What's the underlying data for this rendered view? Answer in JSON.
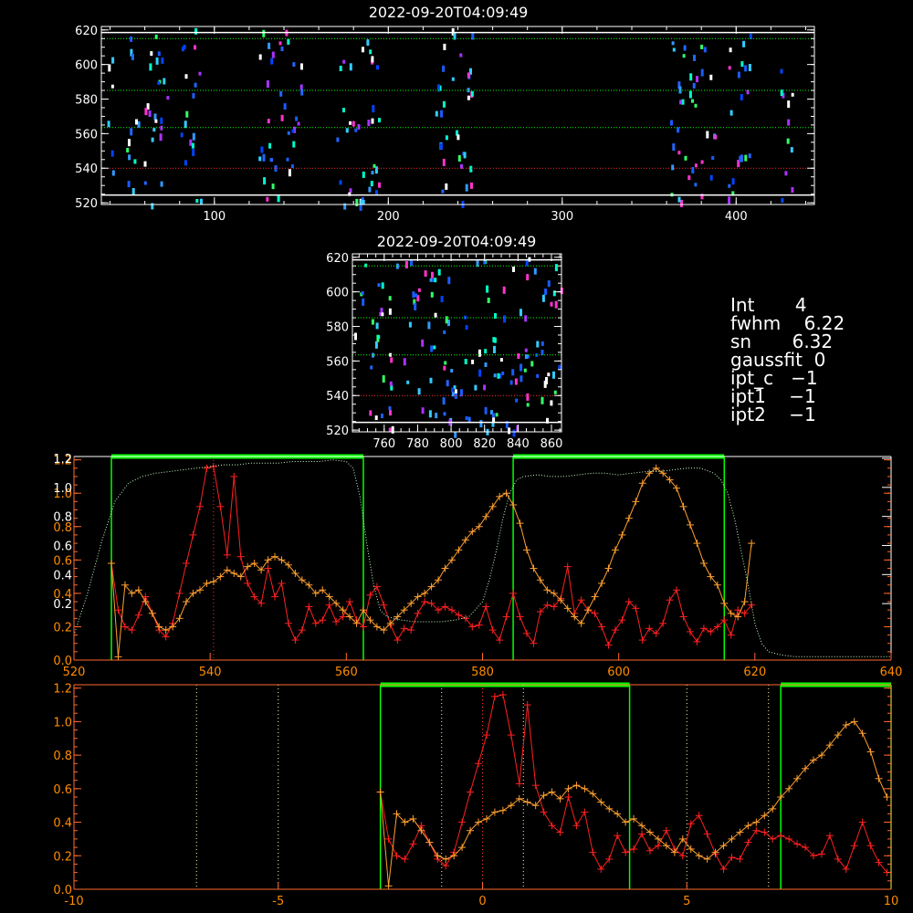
{
  "chart_data": [
    {
      "type": "heatmap",
      "title": "2022-09-20T04:09:49",
      "xlim": [
        35,
        445
      ],
      "ylim": [
        519,
        622
      ],
      "xticks": [
        "100",
        "200",
        "300",
        "400"
      ],
      "xtick_values": [
        100,
        200,
        300,
        400
      ],
      "yticks": [
        "520",
        "540",
        "560",
        "580",
        "600",
        "620"
      ],
      "ytick_values": [
        520,
        540,
        560,
        580,
        600,
        620
      ],
      "solid_hlines": [
        524.5,
        618.5
      ],
      "dotted_hlines": [
        540,
        563.5,
        585,
        615
      ],
      "dotted_hline_colors": [
        "#ff3030",
        "#00ff00",
        "#00ff00",
        "#00ff00"
      ],
      "clusters": [
        [
          38,
          42
        ],
        [
          48,
          56
        ],
        [
          58,
          74
        ],
        [
          80,
          92
        ],
        [
          125,
          150
        ],
        [
          170,
          195
        ],
        [
          225,
          248
        ],
        [
          362,
          388
        ],
        [
          395,
          408
        ],
        [
          425,
          432
        ]
      ]
    },
    {
      "type": "heatmap",
      "title": "2022-09-20T04:09:49",
      "xlim": [
        741,
        866
      ],
      "ylim": [
        519,
        622
      ],
      "xticks": [
        "760",
        "780",
        "800",
        "820",
        "840",
        "860"
      ],
      "xtick_values": [
        760,
        780,
        800,
        820,
        840,
        860
      ],
      "yticks": [
        "520",
        "540",
        "560",
        "580",
        "600",
        "620"
      ],
      "ytick_values": [
        520,
        540,
        560,
        580,
        600,
        620
      ],
      "solid_hlines": [
        524.5,
        618.5
      ],
      "dotted_hlines": [
        540,
        563.5,
        585,
        615
      ],
      "dotted_hline_colors": [
        "#ff3030",
        "#00ff00",
        "#00ff00",
        "#00ff00"
      ]
    },
    {
      "type": "line",
      "xlim": [
        520,
        640
      ],
      "ylim": [
        0,
        1.22
      ],
      "xticks": [
        "520",
        "540",
        "560",
        "580",
        "600",
        "620",
        "640"
      ],
      "xtick_values": [
        520,
        540,
        560,
        580,
        600,
        620,
        640
      ],
      "yticks_orange": [
        "0.0",
        "0.2",
        "0.4",
        "0.6",
        "0.8",
        "1.0",
        "1.2"
      ],
      "yticks_white": [
        "0.2",
        "0.4",
        "0.6",
        "0.8",
        "1.0",
        "1.2"
      ],
      "ytick_values": [
        0,
        0.2,
        0.4,
        0.6,
        0.8,
        1.0,
        1.2
      ],
      "green_windows": [
        [
          525.5,
          562.5
        ],
        [
          584.5,
          615.5
        ]
      ],
      "red_center": 540.5,
      "series": [
        {
          "color": "#ff2020",
          "x": [
            525.5,
            526.5,
            527.5,
            528.5,
            529.5,
            530.5,
            531.5,
            532.5,
            533.5,
            534.5,
            535.5,
            536.5,
            537.5,
            538.5,
            539.5,
            540.5,
            541.5,
            542.5,
            543.5,
            544.5,
            545.5,
            546.5,
            547.5,
            548.5,
            549.5,
            550.5,
            551.5,
            552.5,
            553.5,
            554.5,
            555.5,
            556.5,
            557.5,
            558.5,
            559.5,
            560.5,
            561.5,
            562.5,
            563.5,
            564.5,
            565.5,
            566.5,
            567.5,
            568.5,
            569.5,
            570.5,
            571.5,
            572.5,
            573.5,
            574.5,
            575.5,
            576.5,
            577.5,
            578.5,
            579.5,
            580.5,
            581.5,
            582.5,
            583.5,
            584.5,
            585.5,
            586.5,
            587.5,
            588.5,
            589.5,
            590.5,
            591.5,
            592.5,
            593.5,
            594.5,
            595.5,
            596.5,
            597.5,
            598.5,
            599.5,
            600.5,
            601.5,
            602.5,
            603.5,
            604.5,
            605.5,
            606.5,
            607.5,
            608.5,
            609.5,
            610.5,
            611.5,
            612.5,
            613.5,
            614.5,
            615.5,
            616.5,
            617.5,
            618.5,
            619.5
          ],
          "values": [
            0.58,
            0.3,
            0.2,
            0.18,
            0.27,
            0.38,
            0.28,
            0.18,
            0.14,
            0.22,
            0.4,
            0.58,
            0.75,
            0.92,
            1.15,
            1.16,
            0.92,
            0.63,
            1.1,
            0.62,
            0.46,
            0.38,
            0.34,
            0.55,
            0.38,
            0.46,
            0.22,
            0.12,
            0.18,
            0.32,
            0.22,
            0.24,
            0.33,
            0.23,
            0.26,
            0.35,
            0.24,
            0.2,
            0.39,
            0.44,
            0.33,
            0.21,
            0.12,
            0.19,
            0.18,
            0.28,
            0.35,
            0.34,
            0.3,
            0.32,
            0.3,
            0.27,
            0.25,
            0.2,
            0.21,
            0.32,
            0.18,
            0.12,
            0.26,
            0.4,
            0.26,
            0.16,
            0.1,
            0.29,
            0.33,
            0.32,
            0.37,
            0.56,
            0.28,
            0.36,
            0.3,
            0.28,
            0.2,
            0.09,
            0.18,
            0.24,
            0.35,
            0.31,
            0.12,
            0.19,
            0.16,
            0.22,
            0.36,
            0.42,
            0.26,
            0.17,
            0.11,
            0.19,
            0.17,
            0.2,
            0.24,
            0.15,
            0.3,
            0.28,
            0.33
          ]
        },
        {
          "color": "#ffa030",
          "x": [
            525.5,
            526.5,
            527.5,
            528.5,
            529.5,
            530.5,
            531.5,
            532.5,
            533.5,
            534.5,
            535.5,
            536.5,
            537.5,
            538.5,
            539.5,
            540.5,
            541.5,
            542.5,
            543.5,
            544.5,
            545.5,
            546.5,
            547.5,
            548.5,
            549.5,
            550.5,
            551.5,
            552.5,
            553.5,
            554.5,
            555.5,
            556.5,
            557.5,
            558.5,
            559.5,
            560.5,
            561.5,
            562.5,
            563.5,
            564.5,
            565.5,
            566.5,
            567.5,
            568.5,
            569.5,
            570.5,
            571.5,
            572.5,
            573.5,
            574.5,
            575.5,
            576.5,
            577.5,
            578.5,
            579.5,
            580.5,
            581.5,
            582.5,
            583.5,
            584.5,
            585.5,
            586.5,
            587.5,
            588.5,
            589.5,
            590.5,
            591.5,
            592.5,
            593.5,
            594.5,
            595.5,
            596.5,
            597.5,
            598.5,
            599.5,
            600.5,
            601.5,
            602.5,
            603.5,
            604.5,
            605.5,
            606.5,
            607.5,
            608.5,
            609.5,
            610.5,
            611.5,
            612.5,
            613.5,
            614.5,
            615.5,
            616.5,
            617.5,
            618.5,
            619.5
          ],
          "values": [
            0.58,
            0.02,
            0.45,
            0.4,
            0.42,
            0.35,
            0.28,
            0.2,
            0.18,
            0.2,
            0.25,
            0.35,
            0.4,
            0.42,
            0.46,
            0.47,
            0.5,
            0.54,
            0.52,
            0.5,
            0.56,
            0.58,
            0.54,
            0.6,
            0.62,
            0.6,
            0.57,
            0.52,
            0.48,
            0.45,
            0.4,
            0.42,
            0.38,
            0.34,
            0.3,
            0.26,
            0.22,
            0.3,
            0.24,
            0.2,
            0.18,
            0.22,
            0.26,
            0.3,
            0.34,
            0.38,
            0.4,
            0.44,
            0.48,
            0.55,
            0.6,
            0.66,
            0.72,
            0.77,
            0.8,
            0.86,
            0.92,
            0.98,
            1.0,
            0.93,
            0.82,
            0.66,
            0.55,
            0.48,
            0.42,
            0.4,
            0.36,
            0.31,
            0.26,
            0.22,
            0.3,
            0.38,
            0.46,
            0.55,
            0.66,
            0.75,
            0.85,
            0.95,
            1.06,
            1.12,
            1.15,
            1.12,
            1.08,
            1.03,
            0.92,
            0.81,
            0.7,
            0.58,
            0.5,
            0.45,
            0.34,
            0.28,
            0.26,
            0.35,
            0.7
          ]
        },
        {
          "color": "#c8ffc8",
          "style": "dotted",
          "x": [
            520,
            522,
            524,
            526,
            528,
            530,
            532,
            534,
            536,
            538,
            540,
            542,
            544,
            546,
            548,
            550,
            552,
            554,
            556,
            558,
            560,
            561,
            562,
            563,
            564,
            565,
            566,
            568,
            570,
            572,
            574,
            576,
            578,
            580,
            581,
            582,
            583,
            584,
            585,
            586,
            588,
            590,
            592,
            594,
            596,
            598,
            600,
            602,
            604,
            606,
            608,
            610,
            612,
            614,
            615,
            616,
            617,
            618,
            619,
            620,
            621,
            622,
            624,
            626,
            628,
            630,
            632,
            634,
            636,
            638,
            640
          ],
          "values": [
            0.15,
            0.4,
            0.7,
            0.95,
            1.06,
            1.1,
            1.12,
            1.13,
            1.14,
            1.15,
            1.16,
            1.17,
            1.17,
            1.18,
            1.18,
            1.18,
            1.19,
            1.19,
            1.19,
            1.2,
            1.19,
            1.15,
            0.98,
            0.7,
            0.45,
            0.3,
            0.26,
            0.24,
            0.23,
            0.23,
            0.23,
            0.24,
            0.26,
            0.35,
            0.48,
            0.65,
            0.85,
            1.0,
            1.08,
            1.1,
            1.11,
            1.1,
            1.1,
            1.11,
            1.12,
            1.12,
            1.11,
            1.12,
            1.13,
            1.13,
            1.14,
            1.15,
            1.15,
            1.12,
            1.08,
            1.0,
            0.85,
            0.65,
            0.45,
            0.22,
            0.1,
            0.05,
            0.03,
            0.02,
            0.02,
            0.02,
            0.02,
            0.02,
            0.02,
            0.02,
            0.02
          ]
        }
      ]
    },
    {
      "type": "line",
      "xlim": [
        -10,
        10
      ],
      "ylim": [
        0,
        1.22
      ],
      "xticks": [
        "-10",
        "-5",
        "0",
        "5",
        "10"
      ],
      "xtick_values": [
        -10,
        -5,
        0,
        5,
        10
      ],
      "yticks": [
        "0.0",
        "0.2",
        "0.4",
        "0.6",
        "0.8",
        "1.0",
        "1.2"
      ],
      "ytick_values": [
        0,
        0.2,
        0.4,
        0.6,
        0.8,
        1.0,
        1.2
      ],
      "green_windows": [
        [
          -2.5,
          3.6
        ],
        [
          7.3,
          10.2
        ]
      ],
      "dotted_vlines": [
        -7,
        -5,
        -1,
        1,
        5,
        7
      ],
      "red_center": 0,
      "series": [
        {
          "color": "#ff2020",
          "x0": -2.5,
          "dx": 0.2,
          "values": [
            0.58,
            0.3,
            0.2,
            0.18,
            0.27,
            0.38,
            0.28,
            0.18,
            0.14,
            0.22,
            0.4,
            0.58,
            0.75,
            0.92,
            1.15,
            1.16,
            0.92,
            0.63,
            1.1,
            0.62,
            0.46,
            0.38,
            0.34,
            0.55,
            0.38,
            0.46,
            0.22,
            0.12,
            0.18,
            0.32,
            0.22,
            0.24,
            0.33,
            0.23,
            0.26,
            0.35,
            0.24,
            0.2,
            0.39,
            0.44,
            0.33,
            0.21,
            0.12,
            0.19,
            0.18,
            0.28,
            0.35,
            0.34,
            0.3,
            0.32,
            0.3,
            0.27,
            0.25,
            0.2,
            0.21,
            0.32,
            0.18,
            0.12,
            0.26,
            0.4,
            0.26,
            0.16,
            0.1,
            0.29,
            0.33,
            0.32,
            0.37,
            0.56,
            0.28,
            0.36,
            0.3,
            0.28,
            0.2
          ]
        },
        {
          "color": "#ffa030",
          "x0": -2.5,
          "dx": 0.2,
          "values": [
            0.58,
            0.02,
            0.45,
            0.4,
            0.42,
            0.35,
            0.28,
            0.2,
            0.18,
            0.2,
            0.25,
            0.35,
            0.4,
            0.42,
            0.46,
            0.47,
            0.5,
            0.54,
            0.52,
            0.5,
            0.56,
            0.58,
            0.54,
            0.6,
            0.62,
            0.6,
            0.57,
            0.52,
            0.48,
            0.45,
            0.4,
            0.42,
            0.38,
            0.34,
            0.3,
            0.26,
            0.22,
            0.3,
            0.24,
            0.2,
            0.18,
            0.22,
            0.26,
            0.3,
            0.34,
            0.38,
            0.4,
            0.44,
            0.48,
            0.55,
            0.6,
            0.66,
            0.72,
            0.77,
            0.8,
            0.86,
            0.92,
            0.98,
            1.0,
            0.93,
            0.82,
            0.66,
            0.55,
            0.48,
            0.42,
            0.4,
            0.36,
            0.31,
            0.26,
            0.22,
            0.3,
            0.38,
            0.46,
            0.55,
            0.66,
            0.75,
            0.85,
            0.95,
            1.06,
            1.12,
            1.15,
            1.12,
            1.08,
            1.03,
            0.92,
            0.81,
            0.7,
            0.58,
            0.5,
            0.45,
            0.34,
            0.28,
            0.26,
            0.35
          ]
        }
      ]
    }
  ],
  "info": {
    "lines": [
      "Int       4",
      "fwhm    6.22",
      "sn       6.32",
      "gaussfit  0",
      "ipt_c   −1",
      "ipt1    −1",
      "ipt2    −1"
    ]
  }
}
